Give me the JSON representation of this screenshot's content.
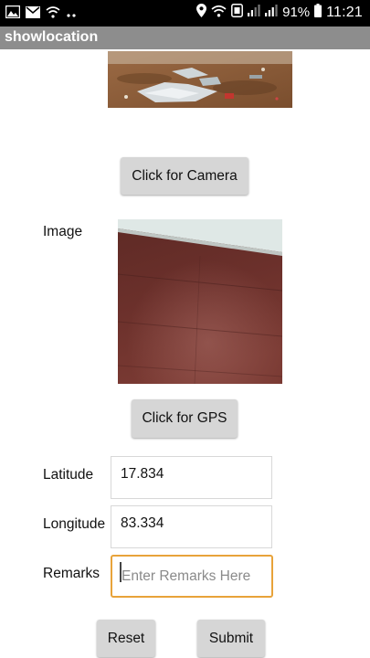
{
  "status_bar": {
    "time": "11:21",
    "battery_percent": "91%",
    "icons_left": [
      "gallery-icon",
      "mail-icon",
      "wifi-icon",
      "more-dots-icon"
    ],
    "icons_right": [
      "location-icon",
      "wifi-icon",
      "data-saver-icon",
      "signal-icon",
      "signal-icon",
      "battery-icon"
    ]
  },
  "app_bar": {
    "title": "showlocation"
  },
  "camera": {
    "button_label": "Click for Camera"
  },
  "image_section": {
    "label": "Image"
  },
  "gps": {
    "button_label": "Click for GPS"
  },
  "form": {
    "latitude_label": "Latitude",
    "latitude_value": "17.834",
    "longitude_label": "Longitude",
    "longitude_value": "83.334",
    "remarks_label": "Remarks",
    "remarks_placeholder": "Enter Remarks Here",
    "remarks_value": ""
  },
  "actions": {
    "reset_label": "Reset",
    "submit_label": "Submit"
  },
  "colors": {
    "status_bar": "#000000",
    "app_bar": "#8d8d8d",
    "button_bg": "#d6d6d6",
    "focus_border": "#e8a33a"
  }
}
